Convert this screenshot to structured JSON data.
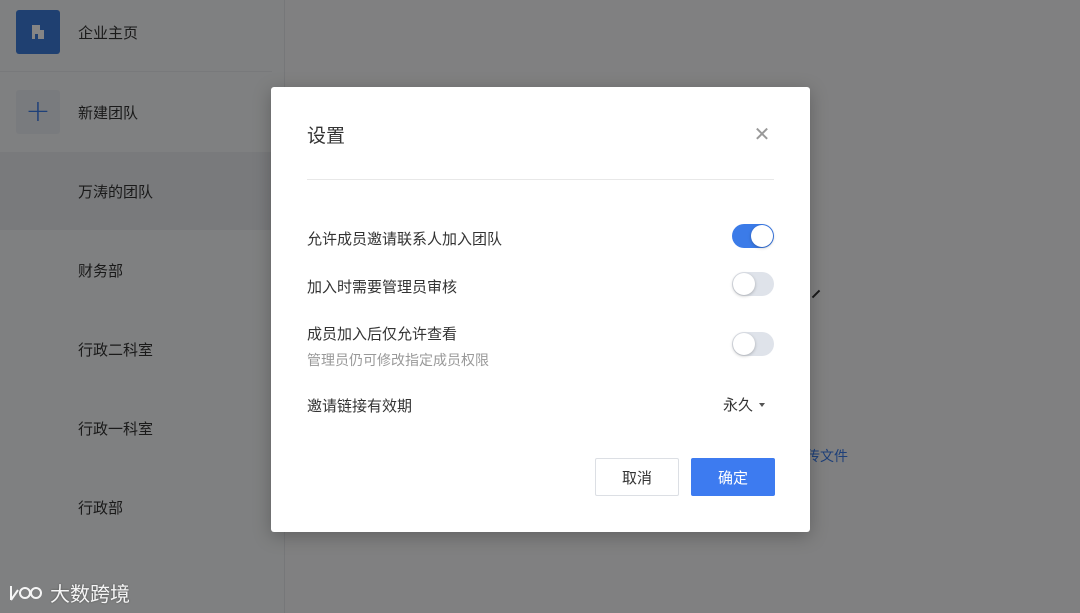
{
  "sidebar": {
    "items": [
      {
        "label": "企业主页",
        "icon": "building-icon"
      },
      {
        "label": "新建团队",
        "icon": "plus-icon"
      },
      {
        "label": "万涛的团队",
        "icon": "team-avatar"
      },
      {
        "label": "财务部",
        "icon": "team-avatar"
      },
      {
        "label": "行政二科室",
        "icon": "team-avatar"
      },
      {
        "label": "行政一科室",
        "icon": "team-avatar"
      },
      {
        "label": "行政部",
        "icon": "team-avatar"
      }
    ]
  },
  "main": {
    "partial_link": "传文件"
  },
  "dialog": {
    "title": "设置",
    "close_icon": "close-icon",
    "rows": [
      {
        "label": "允许成员邀请联系人加入团队",
        "enabled": true
      },
      {
        "label": "加入时需要管理员审核",
        "enabled": false
      },
      {
        "label": "成员加入后仅允许查看",
        "sublabel": "管理员仍可修改指定成员权限",
        "enabled": false
      }
    ],
    "expiry": {
      "label": "邀请链接有效期",
      "value": "永久"
    },
    "cancel_label": "取消",
    "ok_label": "确定"
  },
  "watermark": {
    "text": "大数跨境"
  },
  "colors": {
    "accent": "#3b7be8",
    "overlay": "rgba(0,0,0,0.48)",
    "toggle_off": "#dfe3ea"
  }
}
